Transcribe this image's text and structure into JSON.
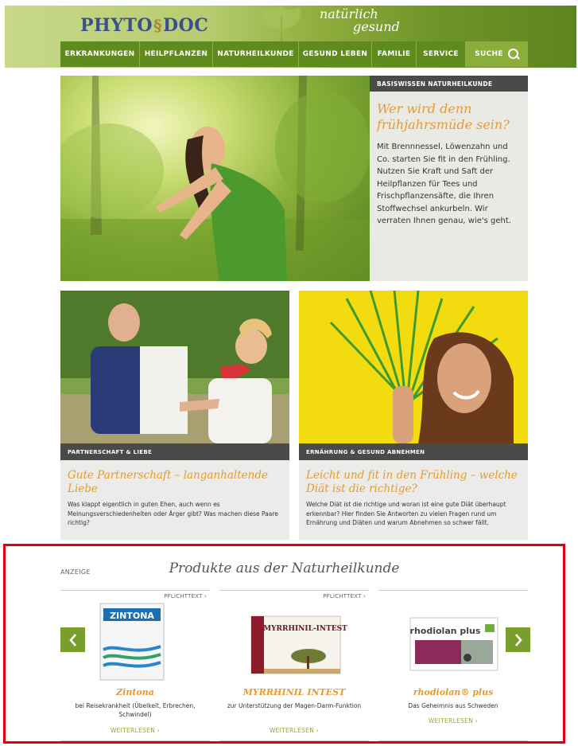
{
  "header": {
    "logo_left": "PHYTO",
    "logo_right": "DOC",
    "slogan_line1": "natürlich",
    "slogan_line2": "gesund",
    "nav": [
      {
        "label": "ERKRANKUNGEN"
      },
      {
        "label": "HEILPFLANZEN"
      },
      {
        "label": "NATURHEILKUNDE"
      },
      {
        "label": "GESUND LEBEN"
      },
      {
        "label": "FAMILIE"
      },
      {
        "label": "SERVICE"
      },
      {
        "label": "SUCHE"
      }
    ]
  },
  "hero": {
    "category": "BASISWISSEN NATURHEILKUNDE",
    "title": "Wer wird denn frühjahrsmüde sein?",
    "text": "Mit Brennnessel, Löwenzahn und Co. starten Sie fit in den Frühling. Nutzen Sie Kraft und Saft der Heilpflanzen für Tees und Frischpflanzensäfte, die Ihren Stoffwechsel ankurbeln. Wir verraten Ihnen genau, wie's geht."
  },
  "teasers": [
    {
      "category": "PARTNERSCHAFT & LIEBE",
      "title": "Gute Partnerschaft – langanhaltende Liebe",
      "text": "Was klappt eigentlich in guten Ehen, auch wenn es Meinungsverschiedenheiten oder Ärger gibt? Was machen diese Paare richtig?"
    },
    {
      "category": "ERNÄHRUNG & GESUND ABNEHMEN",
      "title": "Leicht und fit in den Frühling – welche Diät ist die richtige?",
      "text": "Welche Diät ist die richtige und woran ist eine gute Diät überhaupt erkennbar? Hier finden Sie Antworten zu vielen Fragen rund um Ernährung und Diäten und warum Abnehmen so schwer fällt."
    }
  ],
  "products": {
    "ad_label": "ANZEIGE",
    "heading": "Produkte aus der Naturheilkunde",
    "items": [
      {
        "pflicht": "PFLICHTTEXT ›",
        "name": "Zintona",
        "desc": "bei Reisekrankheit (Übelkeit, Erbrechen, Schwindel)",
        "more": "WEITERLESEN ›",
        "pack_brand": "ZINTONA"
      },
      {
        "pflicht": "PFLICHTTEXT ›",
        "name": "MYRRHINIL INTEST",
        "desc": "zur Unterstützung der Magen-Darm-Funktion",
        "more": "WEITERLESEN ›",
        "pack_brand": "MYRRHINIL-INTEST"
      },
      {
        "pflicht": "",
        "name": "rhodiolan® plus",
        "desc": "Das Geheimnis aus Schweden",
        "more": "WEITERLESEN ›",
        "pack_brand": "rhodiolan plus"
      }
    ]
  },
  "colors": {
    "accent_orange": "#e89a2c",
    "nav_green": "#5f8a1e",
    "button_green": "#7a9e2e",
    "highlight_red": "#e00010"
  }
}
